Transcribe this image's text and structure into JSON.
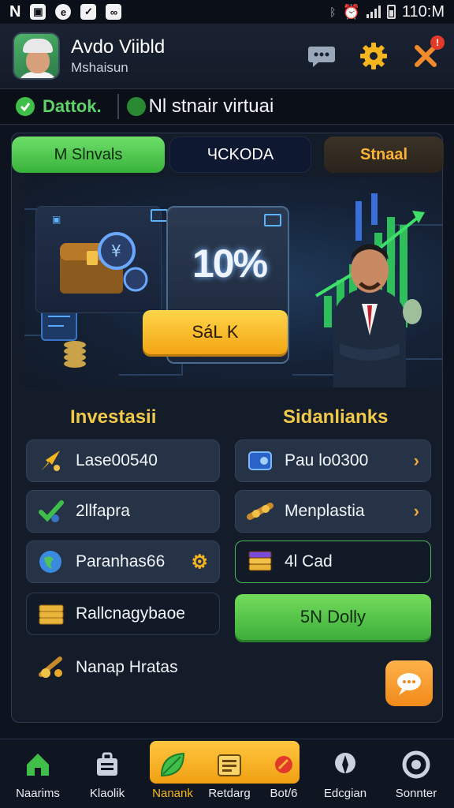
{
  "status_bar": {
    "time": "110:M",
    "left_icons": [
      "n-icon",
      "notification-icon",
      "browser-icon",
      "check-icon",
      "voicemail-icon"
    ]
  },
  "header": {
    "user_name": "Avdo Viibld",
    "user_sub": "Mshaisun",
    "notification_count": "!"
  },
  "status_strip": {
    "status_label": "Dattok.",
    "network_label": "Nl stnair virtuai"
  },
  "tabs": [
    {
      "label": "M Slnvals"
    },
    {
      "label": "ЧCKODA"
    },
    {
      "label": "Stnaal"
    }
  ],
  "banner": {
    "promo_value": "10%",
    "claim_label": "SáL K"
  },
  "sections": {
    "left_title": "Investasii",
    "right_title": "Sidanlianks"
  },
  "left_items": [
    {
      "label": "Lase00540"
    },
    {
      "label": "2llfapra"
    },
    {
      "label": "Paranhas66"
    },
    {
      "label": "Rallcnagybaoe"
    },
    {
      "label": "Nanap Hratas"
    }
  ],
  "right_items": [
    {
      "label": "Pau lo0300"
    },
    {
      "label": "Menplastia"
    },
    {
      "label": "4l Cad"
    }
  ],
  "daily_button": {
    "label": "5N Dolly"
  },
  "bottom_nav": [
    {
      "label": "Naarims"
    },
    {
      "label": "Klaolik"
    },
    {
      "label": "Nanank"
    },
    {
      "label": "Retdarg"
    },
    {
      "label": "Bot/6"
    },
    {
      "label": "Edcgian"
    },
    {
      "label": "Sonnter"
    }
  ],
  "colors": {
    "accent_green": "#3cae3a",
    "accent_gold": "#f2a514",
    "background": "#0d1420"
  }
}
